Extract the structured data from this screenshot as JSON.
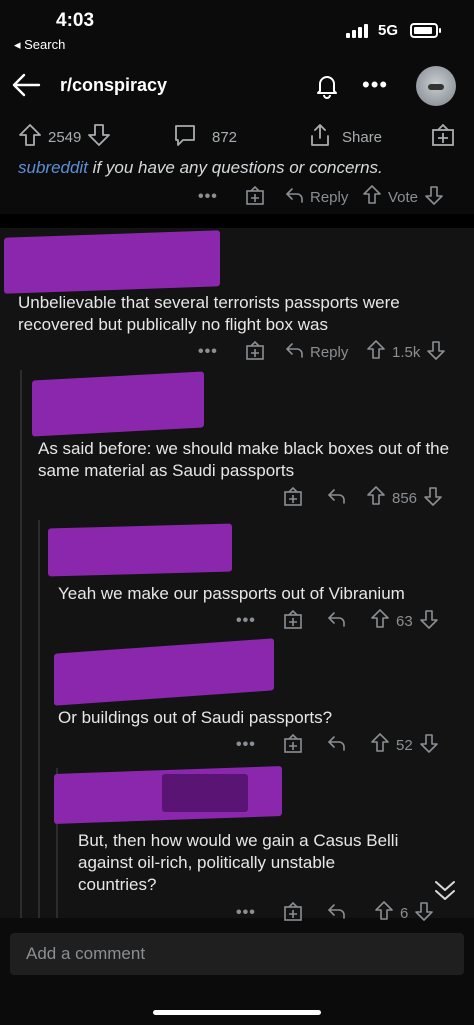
{
  "status": {
    "time": "4:03",
    "back_label": "◂ Search",
    "network": "5G"
  },
  "header": {
    "title": "r/conspiracy"
  },
  "post_actions": {
    "upvotes": "2549",
    "comments": "872",
    "share_label": "Share"
  },
  "mod_note": {
    "link_text": "subreddit",
    "rest_text": " if you have any questions or concerns."
  },
  "mod_actions": {
    "reply_label": "Reply",
    "vote_label": "Vote"
  },
  "comments": [
    {
      "body": "Unbelievable that several terrorists passports were recovered but publically no flight box was",
      "reply_label": "Reply",
      "score": "1.5k"
    },
    {
      "body": "As said before: we should make black boxes out of the same material as Saudi passports",
      "score": "856"
    },
    {
      "body": "Yeah we make our passports out of Vibranium",
      "score": "63"
    },
    {
      "body": "Or buildings out of Saudi passports?",
      "score": "52"
    },
    {
      "body": "But, then how would we gain a Casus Belli against oil-rich, politically unstable countries?",
      "score": "6"
    }
  ],
  "composer": {
    "placeholder": "Add a comment"
  },
  "colors": {
    "redaction": "#8a27ad",
    "link": "#5b8fd6",
    "background": "#131313"
  }
}
